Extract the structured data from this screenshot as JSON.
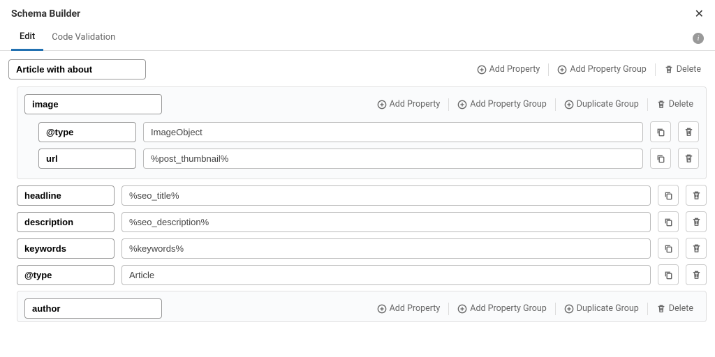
{
  "header": {
    "title": "Schema Builder"
  },
  "tabs": {
    "edit": "Edit",
    "validation": "Code Validation"
  },
  "actions": {
    "add_property": "Add Property",
    "add_property_group": "Add Property Group",
    "duplicate_group": "Duplicate Group",
    "delete": "Delete"
  },
  "schema": {
    "name": "Article with about",
    "groups": [
      {
        "name": "image",
        "props": [
          {
            "key": "@type",
            "value": "ImageObject"
          },
          {
            "key": "url",
            "value": "%post_thumbnail%"
          }
        ]
      }
    ],
    "props": [
      {
        "key": "headline",
        "value": "%seo_title%"
      },
      {
        "key": "description",
        "value": "%seo_description%"
      },
      {
        "key": "keywords",
        "value": "%keywords%"
      },
      {
        "key": "@type",
        "value": "Article"
      }
    ],
    "groups2": [
      {
        "name": "author"
      }
    ]
  }
}
